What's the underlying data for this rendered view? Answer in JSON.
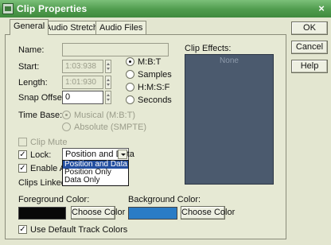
{
  "window": {
    "title": "Clip Properties",
    "close_glyph": "×"
  },
  "tabs": [
    {
      "label": "General",
      "active": true
    },
    {
      "label": "Audio Stretching",
      "active": false
    },
    {
      "label": "Audio Files",
      "active": false
    }
  ],
  "side_buttons": {
    "ok": "OK",
    "cancel": "Cancel",
    "help": "Help"
  },
  "general": {
    "name_label": "Name:",
    "name_value": "",
    "start_label": "Start:",
    "start_value": "1:03:938",
    "length_label": "Length:",
    "length_value": "1:01:930",
    "snap_label": "Snap Offset:",
    "snap_value": "0",
    "time_format": {
      "options": [
        "M:B:T",
        "Samples",
        "H:M:S:F",
        "Seconds"
      ],
      "selected": "M:B:T"
    },
    "time_base_label": "Time Base:",
    "time_base": {
      "options": [
        "Musical (M:B:T)",
        "Absolute (SMPTE)"
      ],
      "selected": "Musical (M:B:T)"
    },
    "clip_mute_label": "Clip Mute",
    "lock_label": "Lock:",
    "enable_label": "Enable Au",
    "clips_linked_label": "Clips Linked to",
    "lock_select": {
      "value": "Position and Data",
      "options": [
        "Position and Data",
        "Position Only",
        "Data Only"
      ],
      "highlighted": "Position and Data"
    },
    "clip_effects_label": "Clip Effects:",
    "clip_effects_empty": "None",
    "foreground_label": "Foreground Color:",
    "background_label": "Background Color:",
    "choose_color_label": "Choose Color",
    "use_default_label": "Use Default Track Colors",
    "colors": {
      "foreground": "#080808",
      "background": "#2a7cc6"
    }
  }
}
